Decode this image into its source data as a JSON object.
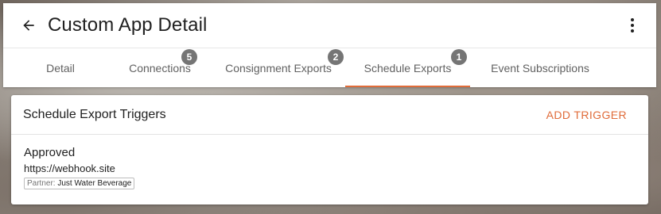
{
  "header": {
    "title": "Custom App Detail"
  },
  "tabs": [
    {
      "label": "Detail",
      "badge": null
    },
    {
      "label": "Connections",
      "badge": "5"
    },
    {
      "label": "Consignment Exports",
      "badge": "2"
    },
    {
      "label": "Schedule Exports",
      "badge": "1",
      "active": true
    },
    {
      "label": "Event Subscriptions",
      "badge": null
    }
  ],
  "card": {
    "title": "Schedule Export Triggers",
    "add_label": "ADD TRIGGER",
    "items": [
      {
        "status": "Approved",
        "url": "https://webhook.site",
        "partner_key": "Partner:",
        "partner_value": "Just Water Beverage"
      }
    ]
  },
  "colors": {
    "accent": "#e06c3a",
    "badge": "#757575"
  }
}
